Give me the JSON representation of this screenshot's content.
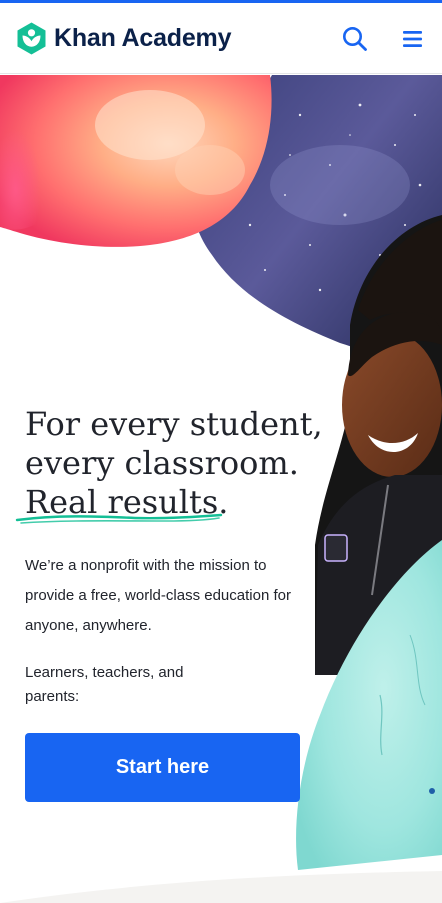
{
  "brand": {
    "name": "Khan Academy",
    "accent_color": "#1865f2",
    "logo_color": "#14bf96",
    "logo_icon": "khan-academy-hexagon-leaf-icon"
  },
  "navbar": {
    "search_icon": "search-icon",
    "menu_icon": "hamburger-menu-icon"
  },
  "hero": {
    "headline_lines": [
      "For every student,",
      "every classroom.",
      "Real results."
    ],
    "mission": "We’re a nonprofit with the mission to provide a free, world-class education for anyone, anywhere.",
    "audience": "Learners, teachers, and parents:",
    "cta_label": "Start here",
    "images": [
      "colorful-smoke-image",
      "starry-night-sky-image",
      "smiling-student-photo",
      "teal-watercolor-image"
    ]
  }
}
